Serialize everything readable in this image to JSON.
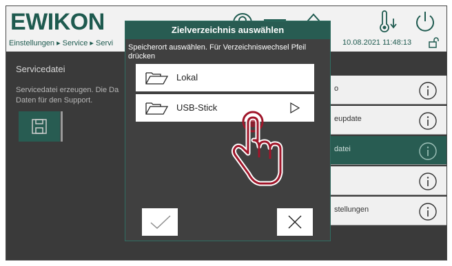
{
  "header": {
    "logo_text": "EWIKON",
    "breadcrumb": "Einstellungen ▸ Service ▸ Servi",
    "datetime": "10.08.2021 11:48:13",
    "icons": [
      "help-icon",
      "menu-icon",
      "home-icon",
      "temperature-icon",
      "power-icon",
      "lock-icon"
    ]
  },
  "left": {
    "title": "Servicedatei",
    "description": "Servicedatei erzeugen. Die Da Daten für den Support.",
    "save_icon": "floppy-disk-icon"
  },
  "right_list": {
    "items": [
      {
        "label": "o",
        "active": false
      },
      {
        "label": "eupdate",
        "active": false
      },
      {
        "label": "datei",
        "active": true
      },
      {
        "label": "",
        "active": false
      },
      {
        "label": "stellungen",
        "active": false
      }
    ],
    "info_icon": "info-icon"
  },
  "dialog": {
    "title": "Zielverzeichnis auswählen",
    "instruction": "Speicherort auswählen. Für Verzeichniswechsel Pfeil drücken",
    "options": [
      {
        "label": "Lokal",
        "icon": "folder-icon",
        "has_arrow": false
      },
      {
        "label": "USB-Stick",
        "icon": "folder-icon",
        "has_arrow": true
      }
    ],
    "confirm_icon": "checkmark-icon",
    "cancel_icon": "close-icon"
  },
  "colors": {
    "brand_green": "#285c52",
    "hand_red": "#a0162a",
    "dark_bg": "#3a3a3a"
  }
}
